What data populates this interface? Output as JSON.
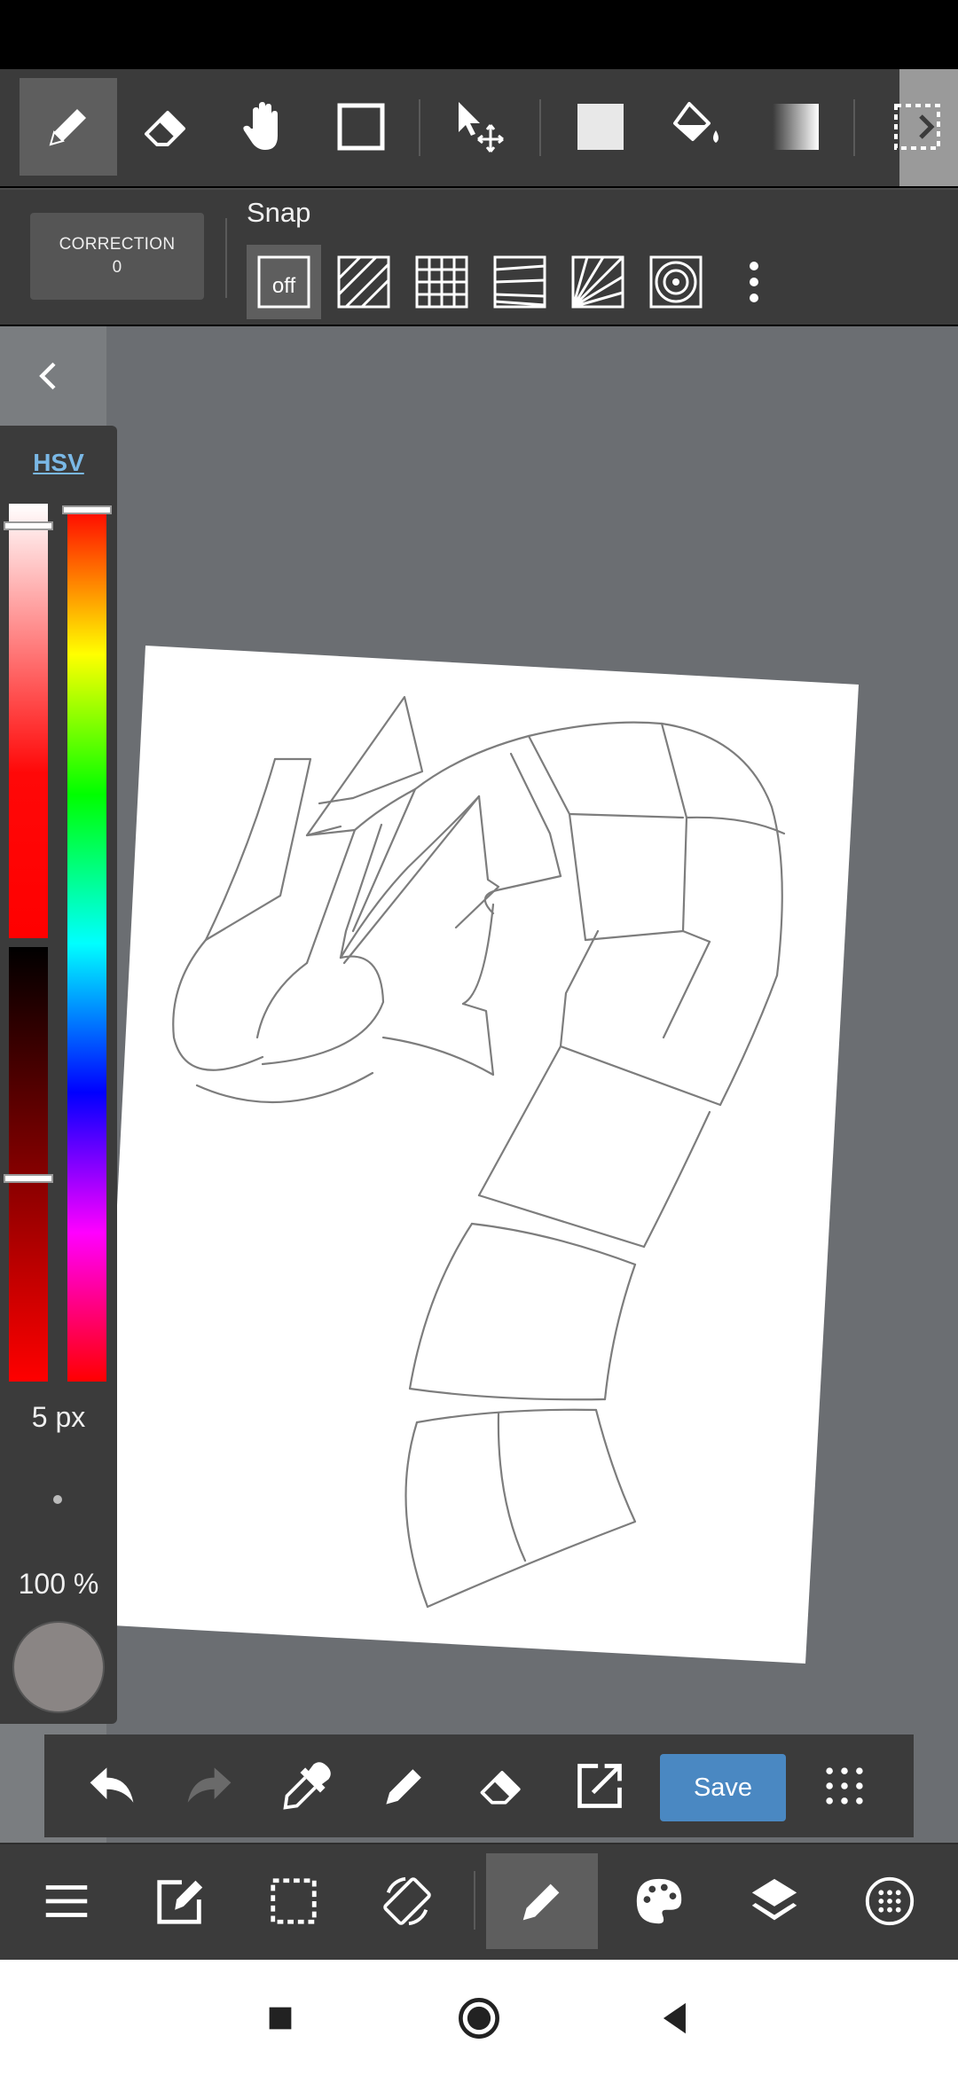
{
  "correction": {
    "label": "CORRECTION",
    "value": "0"
  },
  "snap": {
    "label": "Snap",
    "off_label": "off"
  },
  "color_panel": {
    "mode_label": "HSV",
    "brush_size": "5 px",
    "opacity": "100 %",
    "current_color": "#8a8584"
  },
  "actions": {
    "save_label": "Save"
  },
  "colors": {
    "toolbar_bg": "#3b3b3b",
    "active_bg": "#5e5e5e",
    "canvas_bg": "#6b6e72",
    "save_blue": "#4a88c2",
    "hsv_link": "#7ab8e6"
  },
  "icons": {
    "top_tools": [
      "pen-icon",
      "eraser-icon",
      "hand-icon",
      "square-outline-icon",
      "move-icon",
      "fill-square-icon",
      "bucket-icon",
      "gradient-icon",
      "selection-icon"
    ],
    "snap_tools": [
      "snap-off-icon",
      "parallel-snap-icon",
      "grid-snap-icon",
      "perspective-snap-icon",
      "radial-snap-icon",
      "circle-snap-icon",
      "more-vertical-icon"
    ],
    "actions": [
      "undo-icon",
      "redo-icon",
      "eyedropper-icon",
      "pen-icon",
      "eraser-icon",
      "transform-icon",
      "grid-dots-icon"
    ],
    "bottom_nav": [
      "menu-icon",
      "edit-icon",
      "selection-icon",
      "rotate-icon",
      "brush-icon",
      "palette-icon",
      "layers-icon",
      "material-icon"
    ],
    "system": [
      "recents-icon",
      "home-icon",
      "back-icon"
    ]
  }
}
